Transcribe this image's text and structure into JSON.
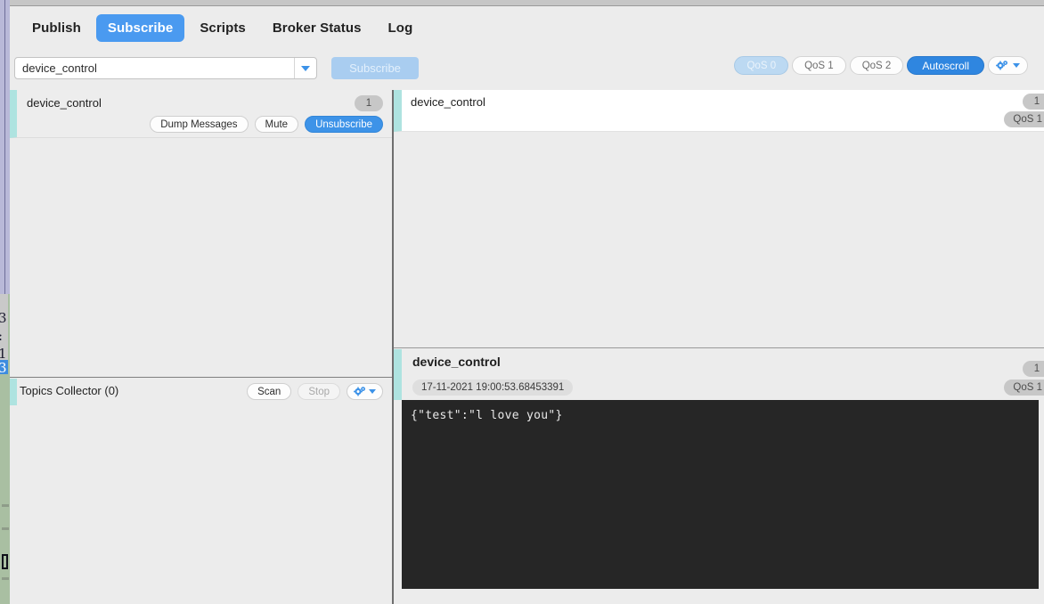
{
  "window": {
    "tabs": [
      {
        "label": "Publish",
        "active": false
      },
      {
        "label": "Subscribe",
        "active": true
      },
      {
        "label": "Scripts",
        "active": false
      },
      {
        "label": "Broker Status",
        "active": false
      },
      {
        "label": "Log",
        "active": false
      }
    ]
  },
  "toolbar": {
    "topic_value": "device_control",
    "topic_placeholder": "Topic",
    "subscribe_label": "Subscribe",
    "qos_options": [
      {
        "label": "QoS 0",
        "selected": true
      },
      {
        "label": "QoS 1",
        "selected": false
      },
      {
        "label": "QoS 2",
        "selected": false
      }
    ],
    "autoscroll_label": "Autoscroll",
    "autoscroll_on": true,
    "options_icon": "gears-dropdown-icon"
  },
  "subscriptions": {
    "items": [
      {
        "topic": "device_control",
        "count": "1",
        "dump_label": "Dump Messages",
        "mute_label": "Mute",
        "unsubscribe_label": "Unsubscribe"
      }
    ]
  },
  "topics_collector": {
    "title": "Topics Collector (0)",
    "scan_label": "Scan",
    "stop_label": "Stop",
    "options_icon": "gears-dropdown-icon"
  },
  "messages": {
    "rows": [
      {
        "topic": "device_control",
        "count": "1",
        "qos": "QoS 1"
      }
    ]
  },
  "message_detail": {
    "topic": "device_control",
    "count": "1",
    "qos": "QoS 1",
    "timestamp": "17-11-2021 19:00:53.68453391",
    "payload": "{\"test\":\"l love you\"}"
  },
  "colors": {
    "accent_blue": "#3d93e8",
    "tab_active_blue": "#4a9af0",
    "panel_accent_teal": "#aee3e0",
    "payload_bg": "#262626",
    "window_bg": "#ececec"
  }
}
